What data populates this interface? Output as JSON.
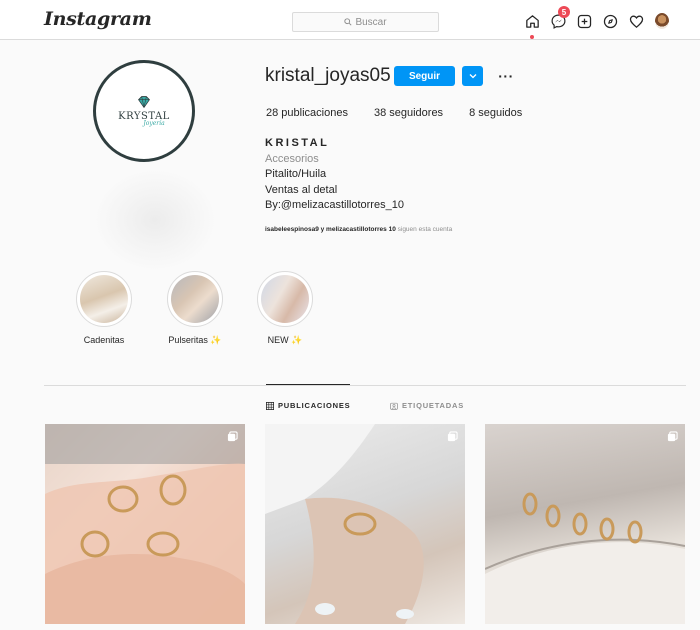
{
  "app": {
    "logo": "Instagram"
  },
  "search": {
    "placeholder": "Buscar"
  },
  "nav": {
    "icons": [
      "home-icon",
      "messenger-icon",
      "new-post-icon",
      "explore-icon",
      "heart-icon",
      "profile-avatar"
    ],
    "messages_badge": "5"
  },
  "profile": {
    "avatar_text": "KRYSTAL",
    "avatar_subtext": "Joyería",
    "username": "kristal_joyas05",
    "follow_label": "Seguir",
    "more_label": "···",
    "stats": {
      "posts": "28 publicaciones",
      "followers": "38 seguidores",
      "following": "8 seguidos"
    },
    "bio": {
      "name": "KRISTAL",
      "category": "Accesorios",
      "line1": "Pitalito/Huila",
      "line2": "Ventas al detal",
      "line3": "By:@melizacastillotorres_10"
    },
    "followed_by": {
      "users": "isabeleespinosa9 y melizacastillotorres",
      "count": "10",
      "suffix": "siguen esta cuenta"
    }
  },
  "highlights": [
    {
      "label": "Cadenitas"
    },
    {
      "label": "Pulseritas ✨"
    },
    {
      "label": "NEW ✨"
    }
  ],
  "tabs": {
    "posts": "PUBLICACIONES",
    "tagged": "ETIQUETADAS"
  },
  "colors": {
    "accent": "#0095f6",
    "badge": "#ed4956",
    "border": "#dbdbdb",
    "muted": "#8e8e8e"
  }
}
